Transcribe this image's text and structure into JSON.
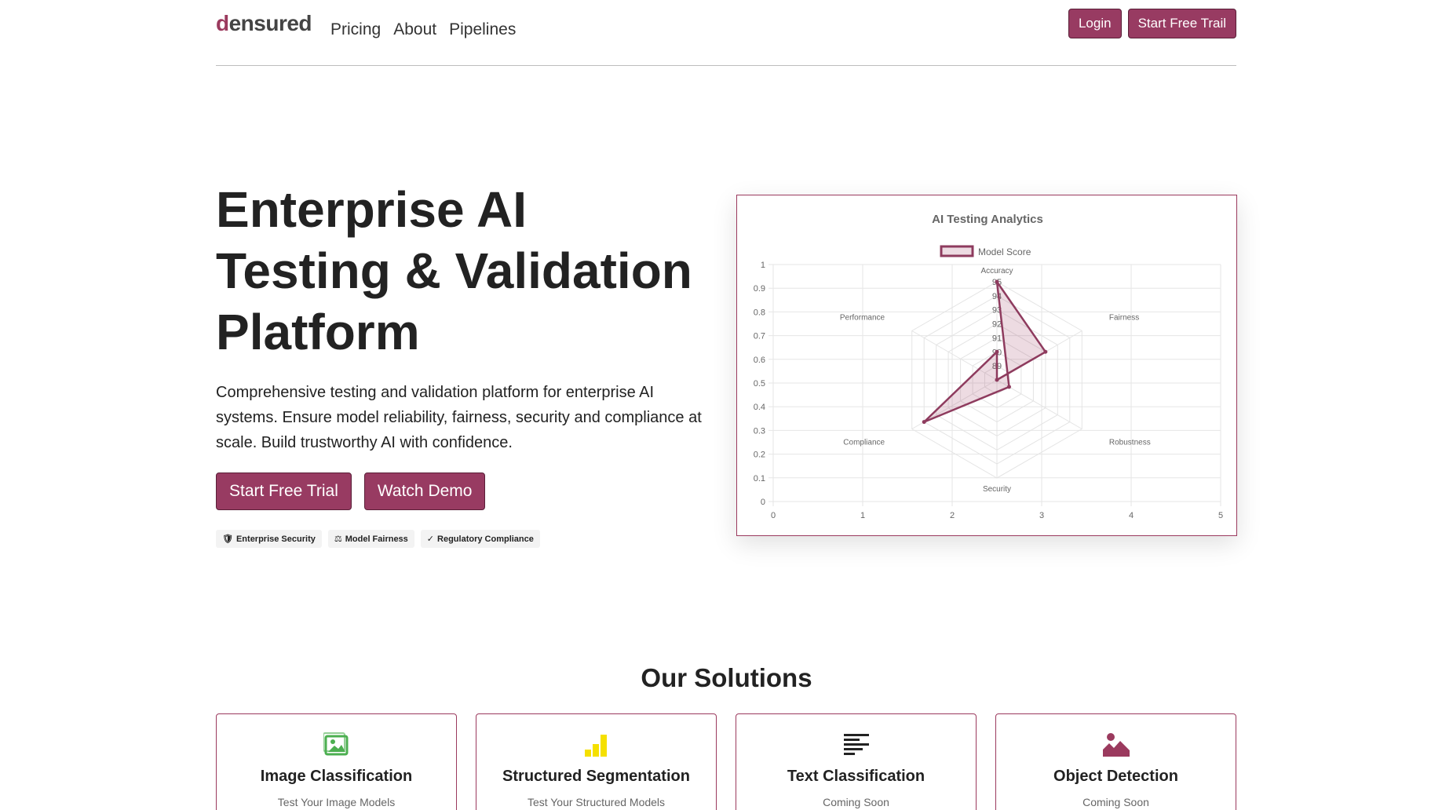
{
  "header": {
    "logo": {
      "mark": "d",
      "rest": "ensured"
    },
    "nav": [
      "Pricing",
      "About",
      "Pipelines"
    ],
    "login_label": "Login",
    "trial_label": "Start Free Trail"
  },
  "hero": {
    "title_lines": [
      "Enterprise AI",
      "Testing & Validation",
      "Platform"
    ],
    "description": "Comprehensive testing and validation platform for enterprise AI systems. Ensure model reliability, fairness, security and compliance at scale. Build trustworthy AI with confidence.",
    "primary_cta": "Start Free Trial",
    "secondary_cta": "Watch Demo",
    "badges": [
      {
        "icon": "shield-icon",
        "glyph": "🛡",
        "label": "Enterprise Security"
      },
      {
        "icon": "scale-icon",
        "glyph": "⚖",
        "label": "Model Fairness"
      },
      {
        "icon": "check-icon",
        "glyph": "✓",
        "label": "Regulatory Compliance"
      }
    ]
  },
  "chart_data": {
    "type": "radar",
    "title": "AI Testing Analytics",
    "legend": [
      "Model Score"
    ],
    "categories": [
      "Accuracy",
      "Fairness",
      "Robustness",
      "Security",
      "Compliance",
      "Performance"
    ],
    "series": [
      {
        "name": "Model Score",
        "values": [
          95,
          92,
          88,
          86,
          94,
          87
        ]
      }
    ],
    "radial_ticks": [
      89,
      90,
      91,
      92,
      93,
      94,
      95
    ],
    "cartesian_axes": {
      "y_ticks": [
        "1",
        "0.9",
        "0.8",
        "0.7",
        "0.6",
        "0.5",
        "0.4",
        "0.3",
        "0.2",
        "0.1",
        "0"
      ],
      "x_ticks": [
        "0",
        "1",
        "2",
        "3",
        "4",
        "5"
      ]
    },
    "colors": {
      "line": "#8e3b5e",
      "fill": "rgba(155,58,94,0.18)"
    }
  },
  "solutions": {
    "title": "Our Solutions",
    "cards": [
      {
        "icon": "image-icon",
        "title": "Image Classification",
        "subtitle": "Test Your Image Models",
        "color": "#4caf50"
      },
      {
        "icon": "bar-chart-icon",
        "title": "Structured Segmentation",
        "subtitle": "Test Your Structured Models",
        "color": "#f5e000"
      },
      {
        "icon": "text-lines-icon",
        "title": "Text Classification",
        "subtitle": "Coming Soon",
        "color": "#222222"
      },
      {
        "icon": "landscape-icon",
        "title": "Object Detection",
        "subtitle": "Coming Soon",
        "color": "#9b3a5e"
      }
    ]
  },
  "theme": {
    "accent": "#983b62",
    "accent_dark": "#5a1f38"
  }
}
